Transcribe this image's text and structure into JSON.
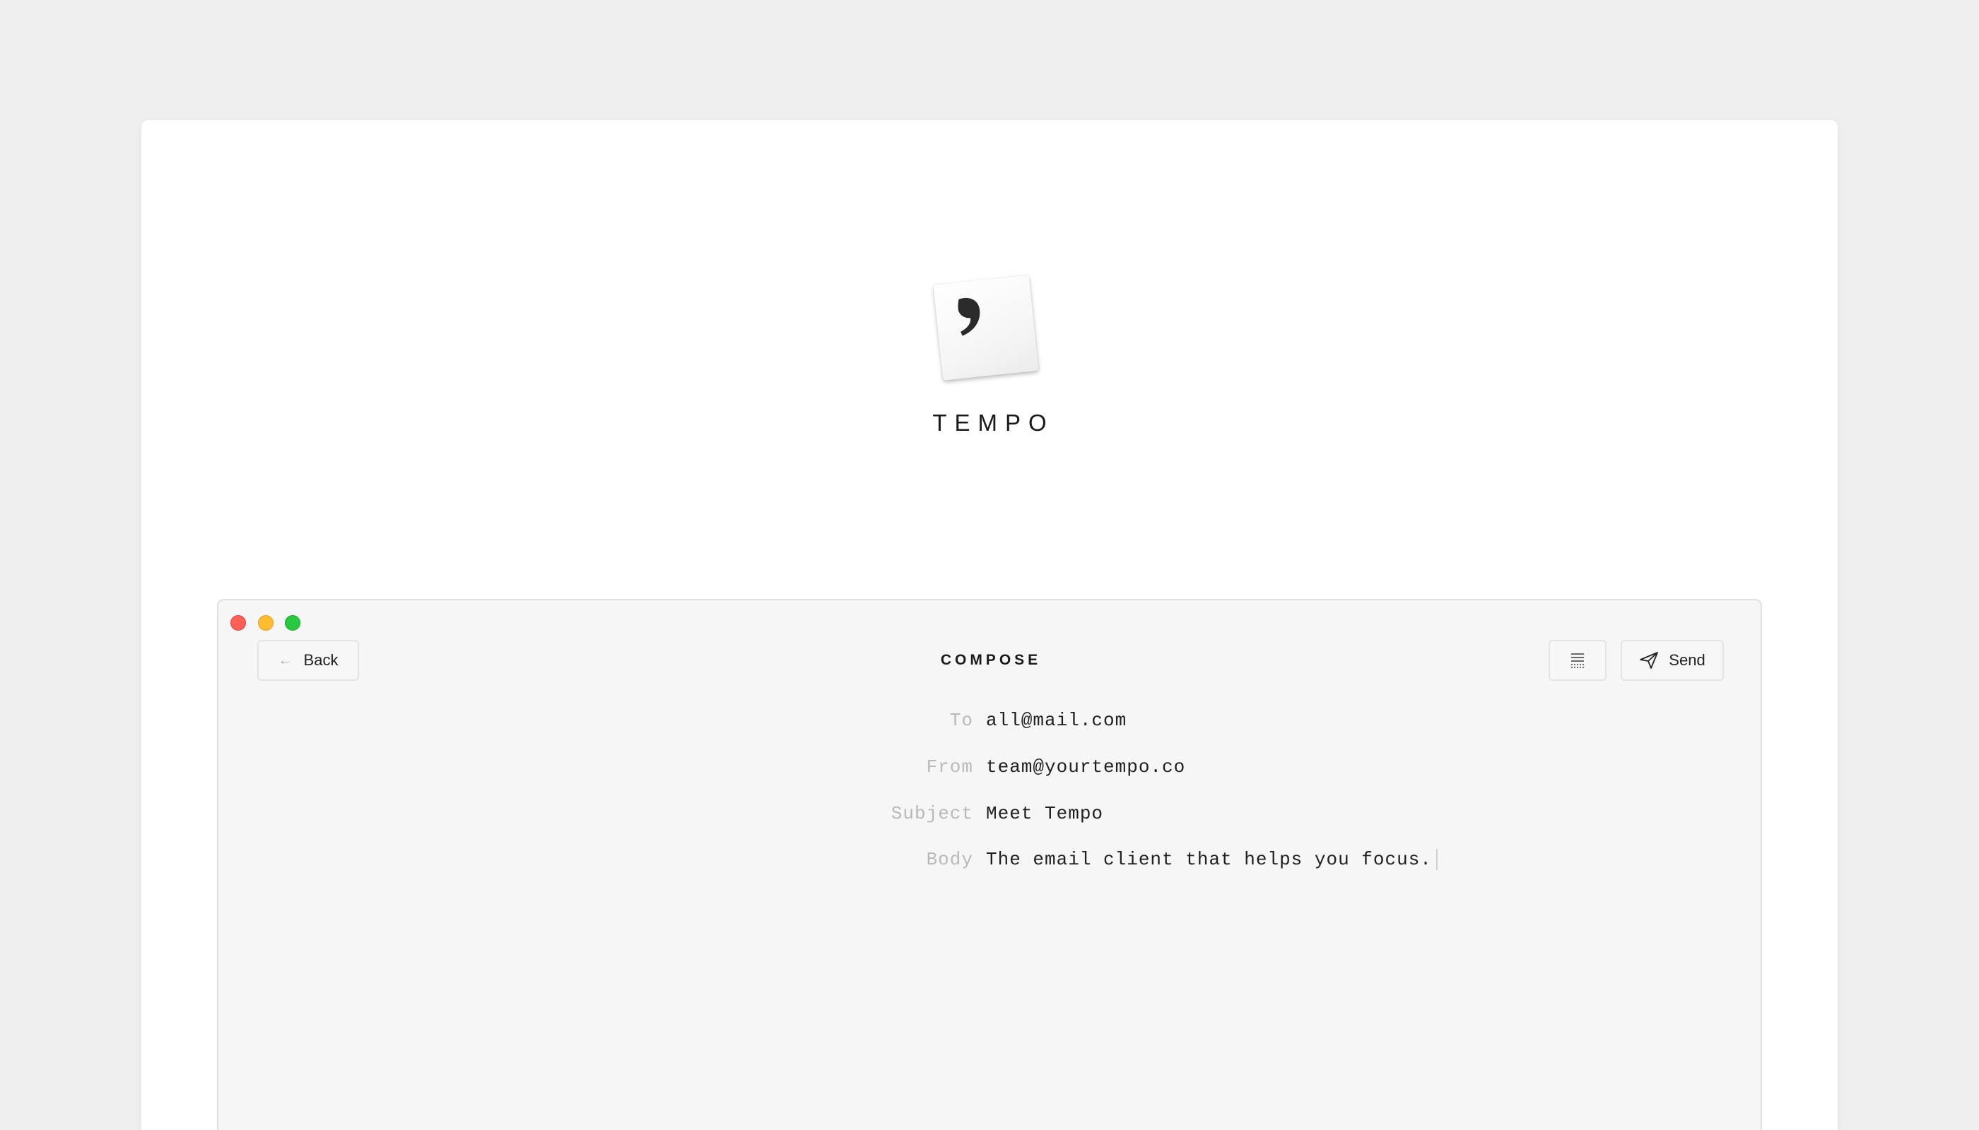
{
  "brand": {
    "name": "TEMPO"
  },
  "window": {
    "title": "COMPOSE",
    "back_label": "Back",
    "send_label": "Send"
  },
  "compose": {
    "to_label": "To",
    "to_value": "all@mail.com",
    "from_label": "From",
    "from_value": "team@yourtempo.co",
    "subject_label": "Subject",
    "subject_value": "Meet Tempo",
    "body_label": "Body",
    "body_value": "The email client that helps you focus."
  },
  "icons": {
    "logo": "comma-paper-icon",
    "back": "arrow-left-icon",
    "draft": "document-lines-icon",
    "send": "paper-plane-icon"
  },
  "colors": {
    "close": "#fe5f57",
    "minimize": "#febc2e",
    "maximize": "#28c840"
  }
}
